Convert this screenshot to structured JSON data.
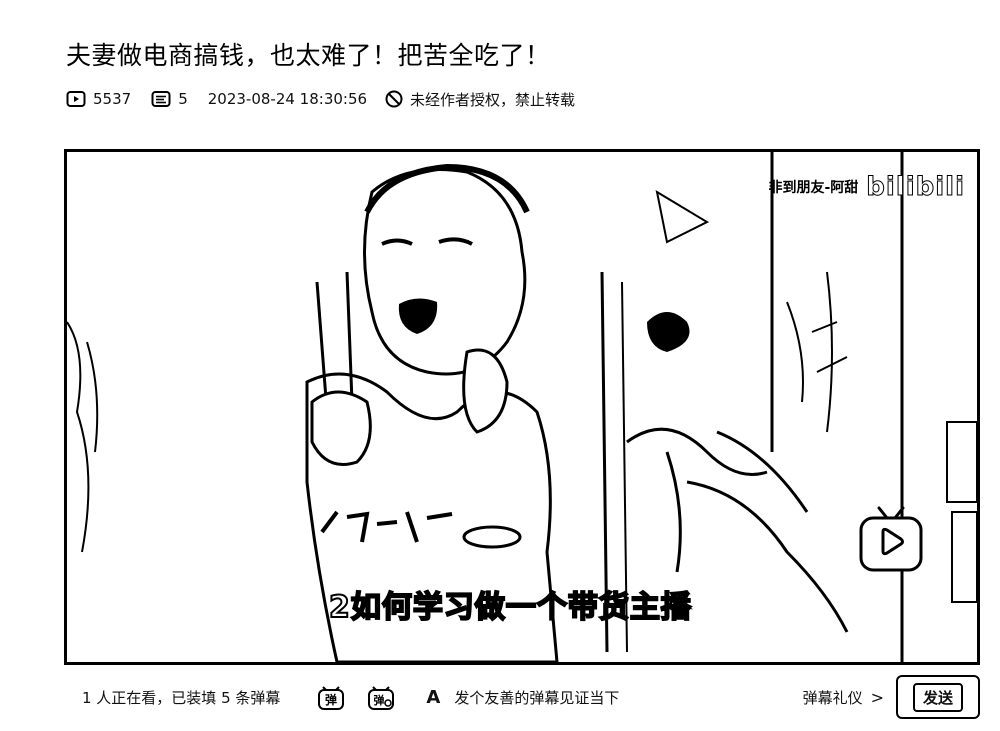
{
  "video": {
    "title": "夫妻做电商搞钱，也太难了！把苦全吃了！",
    "views": "5537",
    "danmaku_count": "5",
    "publish_time": "2023-08-24 18:30:56",
    "copyright_notice": "未经作者授权，禁止转载"
  },
  "player": {
    "watermark_author": "非到朋友-阿甜",
    "watermark_logo": "bilibili",
    "subtitle": "2如何学习做一个带货主播"
  },
  "danmaku_bar": {
    "viewers_text": "1 人正在看，已装填 5 条弹幕",
    "danmaku_toggle_label": "弹",
    "danmaku_settings_label": "弹",
    "font_icon_label": "A",
    "input_placeholder": "发个友善的弹幕见证当下",
    "etiquette_label": "弹幕礼仪",
    "etiquette_chevron": ">",
    "send_label": "发送"
  },
  "icons": {
    "views": "play-count-icon",
    "danmaku": "danmaku-count-icon",
    "copyright": "forbidden-icon",
    "play_badge": "play-badge-icon"
  }
}
